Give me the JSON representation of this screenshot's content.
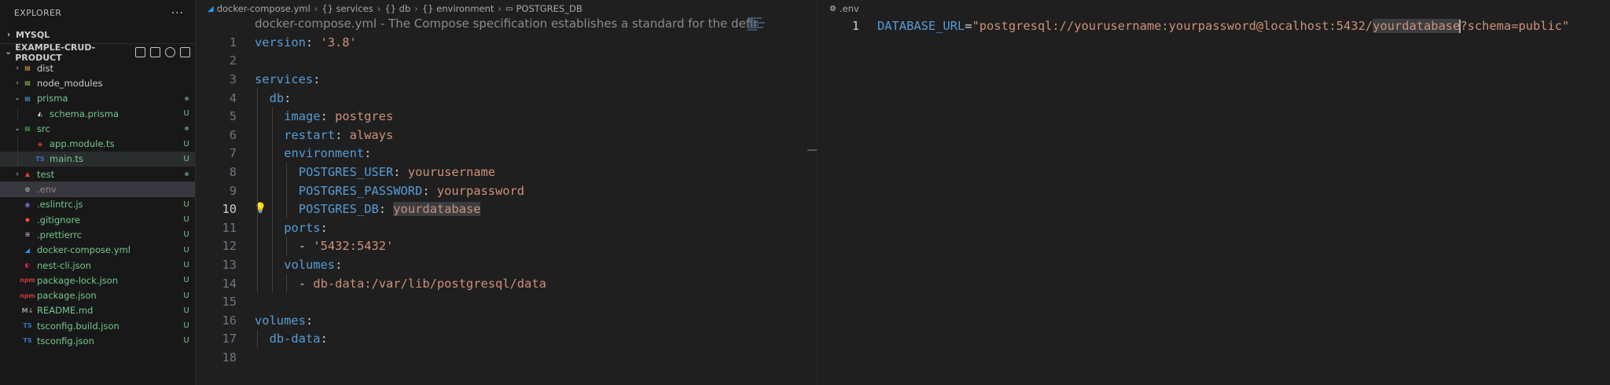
{
  "sidebar": {
    "title": "EXPLORER",
    "more": "···",
    "mysql_section": "MYSQL",
    "project_section": "EXAMPLE-CRUD-PRODUCT",
    "items": [
      {
        "label": "dist",
        "twisty": "›",
        "icon": "folder-dist-icon",
        "glyph": "▤",
        "color": "#cccccc",
        "icon_color": "#e8a03c",
        "status": "",
        "indent": 0,
        "state": ""
      },
      {
        "label": "node_modules",
        "twisty": "›",
        "icon": "folder-node-icon",
        "glyph": "▤",
        "color": "#cccccc",
        "icon_color": "#8bc34a",
        "status": "",
        "indent": 0,
        "state": ""
      },
      {
        "label": "prisma",
        "twisty": "⌄",
        "icon": "folder-prisma-icon",
        "glyph": "▤",
        "color": "#73c991",
        "icon_color": "#4aa3d8",
        "status": "dot",
        "indent": 0,
        "state": ""
      },
      {
        "label": "schema.prisma",
        "twisty": "",
        "icon": "prisma-file-icon",
        "glyph": "◭",
        "color": "#73c991",
        "icon_color": "#dddddd",
        "status": "U",
        "indent": 1,
        "state": ""
      },
      {
        "label": "src",
        "twisty": "⌄",
        "icon": "folder-src-icon",
        "glyph": "▤",
        "color": "#73c991",
        "icon_color": "#4caf50",
        "status": "dot",
        "indent": 0,
        "state": ""
      },
      {
        "label": "app.module.ts",
        "twisty": "",
        "icon": "angular-module-icon",
        "glyph": "◈",
        "color": "#73c991",
        "icon_color": "#e53935",
        "status": "U",
        "indent": 1,
        "state": ""
      },
      {
        "label": "main.ts",
        "twisty": "",
        "icon": "typescript-file-icon",
        "glyph": "TS",
        "color": "#73c991",
        "icon_color": "#3178c6",
        "status": "U",
        "indent": 1,
        "state": "selected"
      },
      {
        "label": "test",
        "twisty": "›",
        "icon": "folder-test-icon",
        "glyph": "▲",
        "color": "#73c991",
        "icon_color": "#e53935",
        "status": "dot",
        "indent": 0,
        "state": ""
      },
      {
        "label": ".env",
        "twisty": "",
        "icon": "gear-icon",
        "glyph": "⚙",
        "color": "#8b8b8b",
        "icon_color": "#c5c5c5",
        "status": "",
        "indent": 0,
        "state": "active"
      },
      {
        "label": ".eslintrc.js",
        "twisty": "",
        "icon": "eslint-file-icon",
        "glyph": "◉",
        "color": "#73c991",
        "icon_color": "#7b6cd9",
        "status": "U",
        "indent": 0,
        "state": ""
      },
      {
        "label": ".gitignore",
        "twisty": "",
        "icon": "git-file-icon",
        "glyph": "◆",
        "color": "#73c991",
        "icon_color": "#f05133",
        "status": "U",
        "indent": 0,
        "state": ""
      },
      {
        "label": ".prettierrc",
        "twisty": "",
        "icon": "prettier-file-icon",
        "glyph": "≡",
        "color": "#73c991",
        "icon_color": "#c596c7",
        "status": "U",
        "indent": 0,
        "state": ""
      },
      {
        "label": "docker-compose.yml",
        "twisty": "",
        "icon": "docker-file-icon",
        "glyph": "◢",
        "color": "#73c991",
        "icon_color": "#2496ed",
        "status": "U",
        "indent": 0,
        "state": ""
      },
      {
        "label": "nest-cli.json",
        "twisty": "",
        "icon": "nest-file-icon",
        "glyph": "◐",
        "color": "#73c991",
        "icon_color": "#e0234e",
        "status": "U",
        "indent": 0,
        "state": ""
      },
      {
        "label": "package-lock.json",
        "twisty": "",
        "icon": "npm-file-icon",
        "glyph": "npm",
        "color": "#73c991",
        "icon_color": "#cb3837",
        "status": "U",
        "indent": 0,
        "state": ""
      },
      {
        "label": "package.json",
        "twisty": "",
        "icon": "npm-file-icon",
        "glyph": "npm",
        "color": "#73c991",
        "icon_color": "#cb3837",
        "status": "U",
        "indent": 0,
        "state": ""
      },
      {
        "label": "README.md",
        "twisty": "",
        "icon": "markdown-file-icon",
        "glyph": "M↓",
        "color": "#73c991",
        "icon_color": "#999999",
        "status": "U",
        "indent": 0,
        "state": ""
      },
      {
        "label": "tsconfig.build.json",
        "twisty": "",
        "icon": "tsconfig-file-icon",
        "glyph": "TS",
        "color": "#73c991",
        "icon_color": "#3178c6",
        "status": "U",
        "indent": 0,
        "state": ""
      },
      {
        "label": "tsconfig.json",
        "twisty": "",
        "icon": "tsconfig-file-icon",
        "glyph": "TS",
        "color": "#73c991",
        "icon_color": "#3178c6",
        "status": "U",
        "indent": 0,
        "state": ""
      }
    ]
  },
  "editor_left": {
    "breadcrumb": [
      "docker-compose.yml",
      "{} services",
      "{} db",
      "{} environment",
      "POSTGRES_DB"
    ],
    "hint": "docker-compose.yml - The Compose specification establishes a standard for the definition of multi-container platform-agnostic applications",
    "current_line": 10,
    "lines": [
      {
        "n": "1",
        "indent": 0,
        "key": "version",
        "sep": ": ",
        "val": "'3.8'",
        "dash": ""
      },
      {
        "n": "2",
        "indent": 0,
        "key": "",
        "sep": "",
        "val": "",
        "dash": ""
      },
      {
        "n": "3",
        "indent": 0,
        "key": "services",
        "sep": ":",
        "val": "",
        "dash": ""
      },
      {
        "n": "4",
        "indent": 1,
        "key": "db",
        "sep": ":",
        "val": "",
        "dash": ""
      },
      {
        "n": "5",
        "indent": 2,
        "key": "image",
        "sep": ": ",
        "val": "postgres",
        "dash": ""
      },
      {
        "n": "6",
        "indent": 2,
        "key": "restart",
        "sep": ": ",
        "val": "always",
        "dash": ""
      },
      {
        "n": "7",
        "indent": 2,
        "key": "environment",
        "sep": ":",
        "val": "",
        "dash": ""
      },
      {
        "n": "8",
        "indent": 3,
        "key": "POSTGRES_USER",
        "sep": ": ",
        "val": "yourusername",
        "dash": ""
      },
      {
        "n": "9",
        "indent": 3,
        "key": "POSTGRES_PASSWORD",
        "sep": ": ",
        "val": "yourpassword",
        "dash": ""
      },
      {
        "n": "10",
        "indent": 3,
        "key": "POSTGRES_DB",
        "sep": ": ",
        "val": "yourdatabase",
        "dash": ""
      },
      {
        "n": "11",
        "indent": 2,
        "key": "ports",
        "sep": ":",
        "val": "",
        "dash": ""
      },
      {
        "n": "12",
        "indent": 3,
        "key": "",
        "sep": "",
        "val": "'5432:5432'",
        "dash": "- "
      },
      {
        "n": "13",
        "indent": 2,
        "key": "volumes",
        "sep": ":",
        "val": "",
        "dash": ""
      },
      {
        "n": "14",
        "indent": 3,
        "key": "",
        "sep": "",
        "val": "db-data:/var/lib/postgresql/data",
        "dash": "- "
      },
      {
        "n": "15",
        "indent": 0,
        "key": "",
        "sep": "",
        "val": "",
        "dash": ""
      },
      {
        "n": "16",
        "indent": 0,
        "key": "volumes",
        "sep": ":",
        "val": "",
        "dash": ""
      },
      {
        "n": "17",
        "indent": 1,
        "key": "db-data",
        "sep": ":",
        "val": "",
        "dash": ""
      },
      {
        "n": "18",
        "indent": 0,
        "key": "",
        "sep": "",
        "val": "",
        "dash": ""
      }
    ]
  },
  "editor_right": {
    "breadcrumb": ".env",
    "line_number": "1",
    "key": "DATABASE_URL",
    "eq": "=",
    "value_before": "\"postgresql://yourusername:yourpassword@localhost:5432/",
    "value_selected": "yourdatabase",
    "value_after": "?schema=public\""
  }
}
